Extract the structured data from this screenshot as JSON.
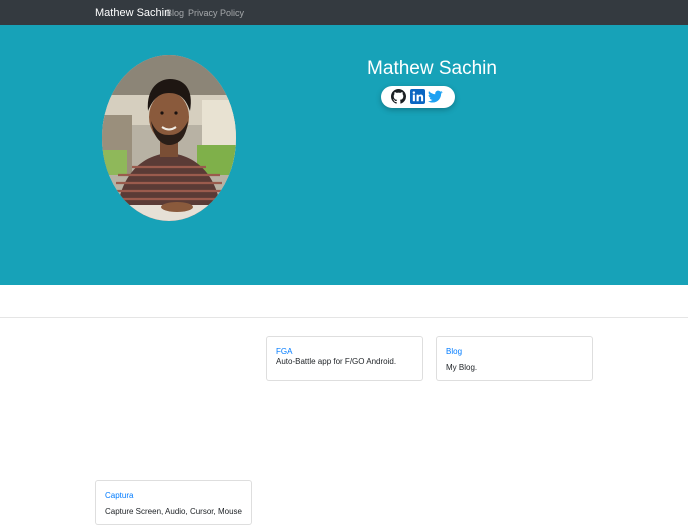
{
  "navbar": {
    "brand": "Mathew Sachin",
    "links": [
      "Blog",
      "Privacy Policy"
    ]
  },
  "hero": {
    "name": "Mathew Sachin",
    "background_color": "#17a2b8",
    "photo_alt": "profile photo",
    "social": [
      {
        "icon": "github-icon",
        "label": "GitHub"
      },
      {
        "icon": "linkedin-icon",
        "label": "LinkedIn"
      },
      {
        "icon": "twitter-icon",
        "label": "Twitter"
      }
    ]
  },
  "projects": [
    {
      "title": "FGA",
      "description": "Auto-Battle app for F/GO Android."
    },
    {
      "title": "Blog",
      "description": "My Blog."
    },
    {
      "title": "Captura",
      "description": "Capture Screen, Audio, Cursor, Mouse"
    }
  ],
  "colors": {
    "navbar": "#343a40",
    "accent": "#17a2b8",
    "link": "#007bff"
  }
}
